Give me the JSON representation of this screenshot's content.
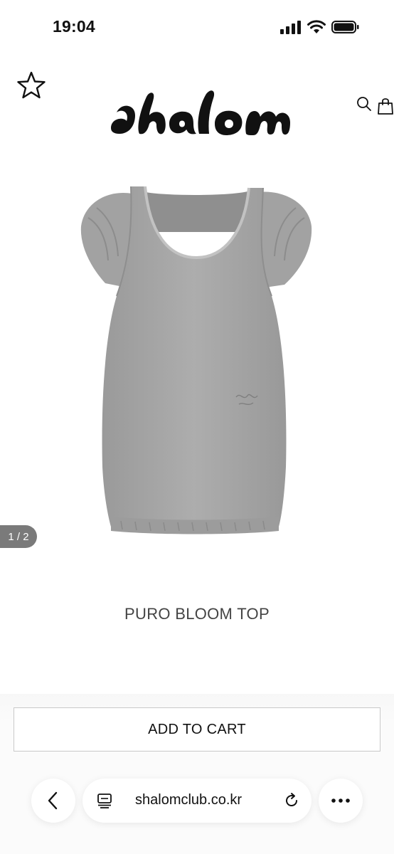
{
  "status_bar": {
    "time": "19:04"
  },
  "header": {
    "brand": "shalom"
  },
  "gallery": {
    "pager": "1 / 2"
  },
  "product": {
    "title": "PURO BLOOM TOP"
  },
  "actions": {
    "add_to_cart": "ADD TO CART"
  },
  "browser": {
    "url": "shalomclub.co.kr"
  },
  "icons": {
    "favorite": "star-icon",
    "search": "search-icon",
    "bag": "shopping-bag-icon",
    "back": "chevron-left-icon",
    "reader": "reader-mode-icon",
    "reload": "reload-icon",
    "more": "more-icon"
  },
  "colors": {
    "garment": "#a8a8a8",
    "pager_bg": "#7a7a7a",
    "button_border": "#c9c9c9"
  }
}
